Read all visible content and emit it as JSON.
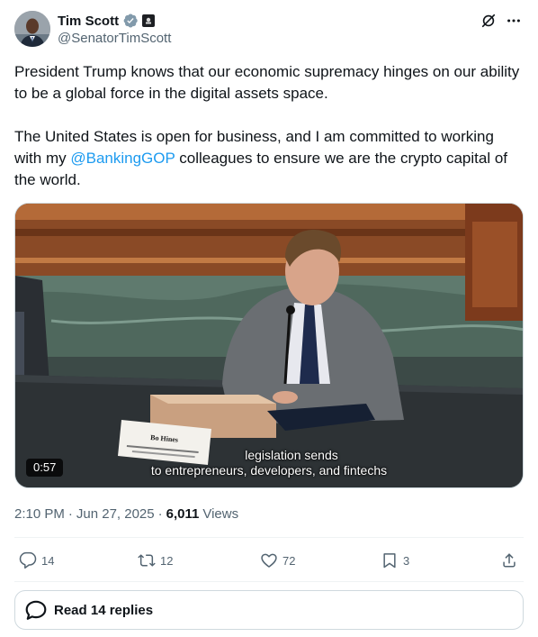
{
  "author": {
    "display_name": "Tim Scott",
    "handle": "@SenatorTimScott"
  },
  "post": {
    "paragraph1": "President Trump knows that our economic supremacy hinges on our ability to be a global force in the digital assets space.",
    "paragraph2_before": "The United States is open for business, and I am committed to working with my ",
    "mention": "@BankingGOP",
    "paragraph2_after": " colleagues to ensure we are the crypto capital of the world."
  },
  "media": {
    "caption_line1": "legislation sends",
    "caption_line2": "to entrepreneurs, developers, and fintechs",
    "duration": "0:57",
    "nameplate_line1": "Bo Hines"
  },
  "meta": {
    "time": "2:10 PM",
    "separator": "·",
    "date": "Jun 27, 2025",
    "views_count": "6,011",
    "views_label": "Views"
  },
  "actions": {
    "replies": "14",
    "reposts": "12",
    "likes": "72",
    "bookmarks": "3"
  },
  "read_replies_label": "Read 14 replies",
  "icons": {
    "verified": "verified-badge-icon",
    "affiliation": "senate-affiliation-icon",
    "grok": "grok-icon",
    "more": "more-icon",
    "reply": "reply-icon",
    "repost": "repost-icon",
    "like": "heart-icon",
    "bookmark": "bookmark-icon",
    "share": "share-icon",
    "read_replies": "speech-bubble-icon"
  },
  "colors": {
    "accent": "#1d9bf0",
    "text_primary": "#0f1419",
    "text_secondary": "#536471",
    "border": "#cfd9de",
    "verified_badge": "#829aab"
  }
}
